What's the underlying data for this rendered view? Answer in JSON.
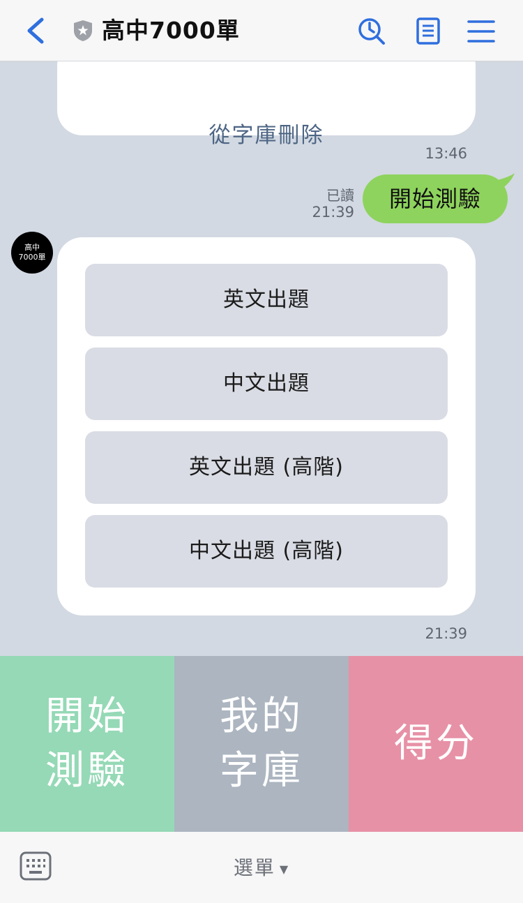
{
  "header": {
    "title": "高中7000單",
    "icons": [
      "back-icon",
      "official-badge-icon",
      "search-history-icon",
      "notes-icon",
      "menu-icon"
    ],
    "accent_color": "#2f6fde"
  },
  "chat": {
    "top_card": {
      "link": "從字庫刪除"
    },
    "time_1": "13:46",
    "user_message": {
      "text": "開始測驗",
      "read_label": "已讀",
      "time": "21:39",
      "color": "#8ed35d"
    },
    "bot": {
      "avatar": {
        "line1": "高中",
        "line2": "7000單"
      },
      "options": [
        {
          "label": "英文出題"
        },
        {
          "label": "中文出題"
        },
        {
          "label": "英文出題 (高階)"
        },
        {
          "label": "中文出題 (高階)"
        }
      ],
      "time": "21:39"
    }
  },
  "richmenu": {
    "start": {
      "line1": "開始",
      "line2": "測驗",
      "color": "#95d9b6"
    },
    "vocab": {
      "line1": "我的",
      "line2": "字庫",
      "color": "#acb5c0"
    },
    "score": {
      "label": "得分",
      "color": "#e791a6"
    }
  },
  "bottom_bar": {
    "menu_label": "選單"
  }
}
